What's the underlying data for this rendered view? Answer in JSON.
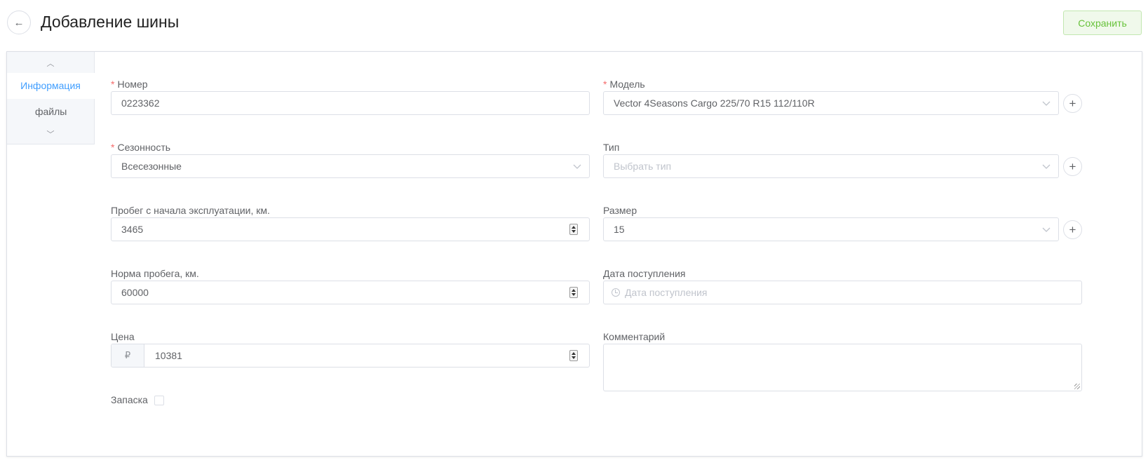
{
  "header": {
    "back_icon": "arrow-left-icon",
    "title": "Добавление шины",
    "save_label": "Сохранить"
  },
  "tabs": {
    "items": [
      {
        "label": "Информация",
        "active": true
      },
      {
        "label": "файлы",
        "active": false
      }
    ]
  },
  "form": {
    "number": {
      "label": "Номер",
      "required": "*",
      "value": "0223362"
    },
    "model": {
      "label": "Модель",
      "required": "*",
      "value": "Vector 4Seasons Cargo 225/70 R15 112/110R"
    },
    "season": {
      "label": "Сезонность",
      "required": "*",
      "value": "Всесезонные"
    },
    "type": {
      "label": "Тип",
      "placeholder": "Выбрать тип"
    },
    "mileage": {
      "label": "Пробег с начала эксплуатации, км.",
      "value": "3465"
    },
    "size": {
      "label": "Размер",
      "value": "15"
    },
    "mileage_norm": {
      "label": "Норма пробега, км.",
      "value": "60000"
    },
    "receipt_date": {
      "label": "Дата поступления",
      "placeholder": "Дата поступления"
    },
    "price": {
      "label": "Цена",
      "currency": "₽",
      "value": "10381"
    },
    "comment": {
      "label": "Комментарий",
      "value": ""
    },
    "spare": {
      "label": "Запаска",
      "checked": false
    }
  },
  "colors": {
    "accent": "#409eff",
    "required": "#f56c6c",
    "save_text": "#67c23a",
    "save_bg": "#f0f9eb"
  }
}
